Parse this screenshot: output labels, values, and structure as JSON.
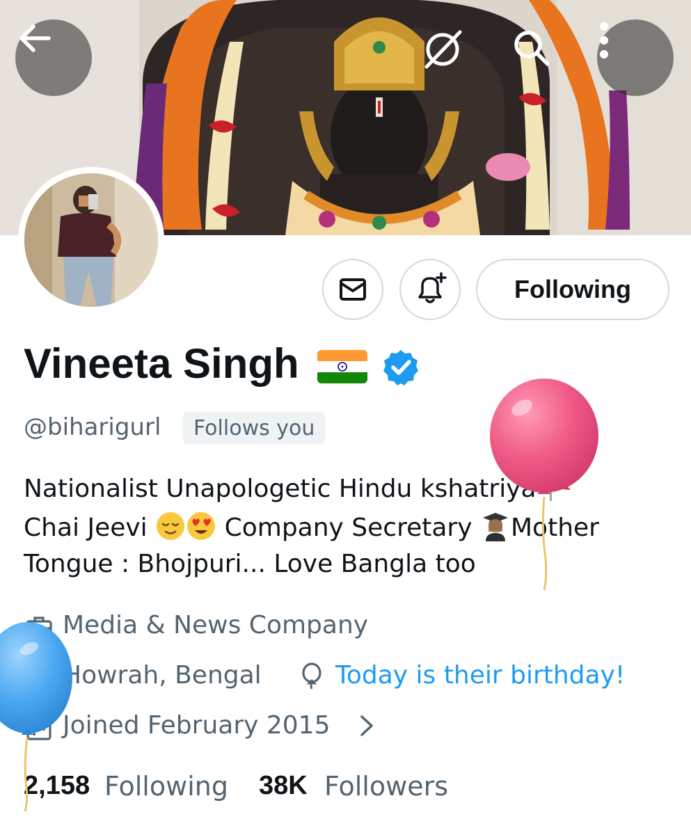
{
  "header": {
    "back_icon": "arrow-left-icon",
    "grok_icon": "grok-icon",
    "search_icon": "search-icon",
    "more_icon": "more-vertical-icon"
  },
  "actions": {
    "message_icon": "envelope-icon",
    "notify_icon": "bell-plus-icon",
    "following_label": "Following"
  },
  "profile": {
    "name": "Vineeta Singh",
    "flag_icon": "india-flag-icon",
    "verified_icon": "verified-badge-icon",
    "handle": "@biharigurl",
    "follows_you": "Follows you",
    "bio": {
      "line1": "Nationalist Unapologetic Hindu kshatriya",
      "line1_emoji": "red-flag-emoji",
      "line2_a": "Chai Jeevi",
      "line2_emojis": [
        "relieved-face-emoji",
        "heart-eyes-emoji"
      ],
      "line2_b": "Company Secretary",
      "line2_emoji": "woman-graduate-emoji",
      "line2_c": "Mother",
      "line3": "Tongue : Bhojpuri... Love Bangla too"
    },
    "category": "Media & News Company",
    "location": "Howrah, Bengal",
    "birthday": "Today is their birthday!",
    "joined": "Joined February 2015"
  },
  "stats": {
    "following_count": "2,158",
    "following_label": "Following",
    "followers_count": "38K",
    "followers_label": "Followers"
  },
  "colors": {
    "accent": "#1d9bf0",
    "secondary_text": "#536471",
    "border": "#cfd9de",
    "balloon_pink": "#f05a86",
    "balloon_blue": "#4aa8f0"
  }
}
